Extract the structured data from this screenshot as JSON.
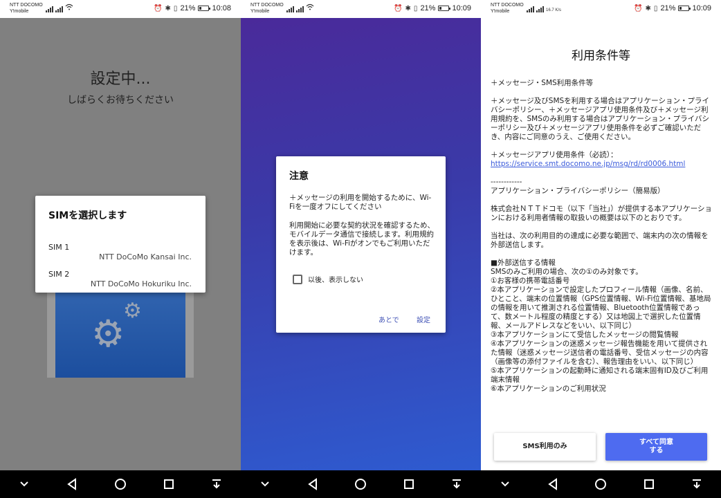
{
  "statusbars": [
    {
      "carrier1": "NTT DOCOMO",
      "carrier2": "Y!mobile",
      "battery": "21%",
      "time": "10:08",
      "speed": ""
    },
    {
      "carrier1": "NTT DOCOMO",
      "carrier2": "Y!mobile",
      "battery": "21%",
      "time": "10:09",
      "speed": ""
    },
    {
      "carrier1": "NTT DOCOMO",
      "carrier2": "Y!mobile",
      "battery": "21%",
      "time": "10:09",
      "speed": "16.7 K/s"
    }
  ],
  "panel1": {
    "title": "設定中...",
    "subtitle": "しばらくお待ちください",
    "dialog": {
      "title": "SIMを選択します",
      "sims": [
        {
          "label": "SIM 1",
          "carrier": "NTT DoCoMo Kansai Inc."
        },
        {
          "label": "SIM 2",
          "carrier": "NTT DoCoMo Hokuriku Inc."
        }
      ]
    }
  },
  "panel2": {
    "dialog": {
      "title": "注意",
      "message1": "＋メッセージの利用を開始するために、Wi-Fiを一度オフにしてください",
      "message2": "利用開始に必要な契約状況を確認するため、モバイルデータ通信で接続します。利用規約を表示後は、Wi-Fiがオンでもご利用いただけます。",
      "checkbox_label": "以後、表示しない",
      "later_button": "あとで",
      "settings_button": "設定"
    }
  },
  "panel3": {
    "title": "利用条件等",
    "heading": "＋メッセージ・SMS利用条件等",
    "para1": "＋メッセージ及びSMSを利用する場合はアプリケーション・プライバシーポリシー、＋メッセージアプリ使用条件及び＋メッセージ利用規約を、SMSのみ利用する場合はアプリケーション・プライバシーポリシー及び＋メッセージアプリ使用条件を必ずご確認いただき、内容にご同意のうえ、ご使用ください。",
    "app_terms_label": "＋メッセージアプリ使用条件（必読）：",
    "app_terms_link": "https://service.smt.docomo.ne.jp/msg/rd/rd0006.html",
    "divider": "------------",
    "policy_title": "アプリケーション・プライバシーポリシー（簡易版）",
    "para2": "株式会社ＮＴＴドコモ（以下「当社」）が提供する本アプリケーションにおける利用者情報の取扱いの概要は以下のとおりです。",
    "para3": "当社は、次の利用目的の達成に必要な範囲で、端末内の次の情報を外部送信します。",
    "list": [
      "■外部送信する情報",
      "SMSのみご利用の場合、次の①のみ対象です。",
      "①お客様の携帯電話番号",
      "②本アプリケーションで設定したプロフィール情報（画像、名前、ひとこと、端末の位置情報（GPS位置情報、Wi-Fi位置情報、基地局の情報を用いて推測される位置情報、Bluetooth位置情報であって、数メートル程度の精度とする）又は地図上で選択した位置情報、メールアドレスなどをいい、以下同じ）",
      "③本アプリケーションにて受信したメッセージの閲覧情報",
      "④本アプリケーションの迷惑メッセージ報告機能を用いて提供された情報（迷惑メッセージ送信者の電話番号、受信メッセージの内容（画像等の添付ファイルを含む）、報告理由をいい、以下同じ）",
      "⑤本アプリケーションの起動時に通知される端末固有ID及びご利用端末情報",
      "⑥本アプリケーションのご利用状況"
    ],
    "sms_only_button": "SMS利用のみ",
    "agree_all_button": "すべて同意する"
  },
  "colors": {
    "primary_button": "#4e6bf0",
    "dialog_action": "#3f51b5",
    "link": "#3b5bdb"
  }
}
